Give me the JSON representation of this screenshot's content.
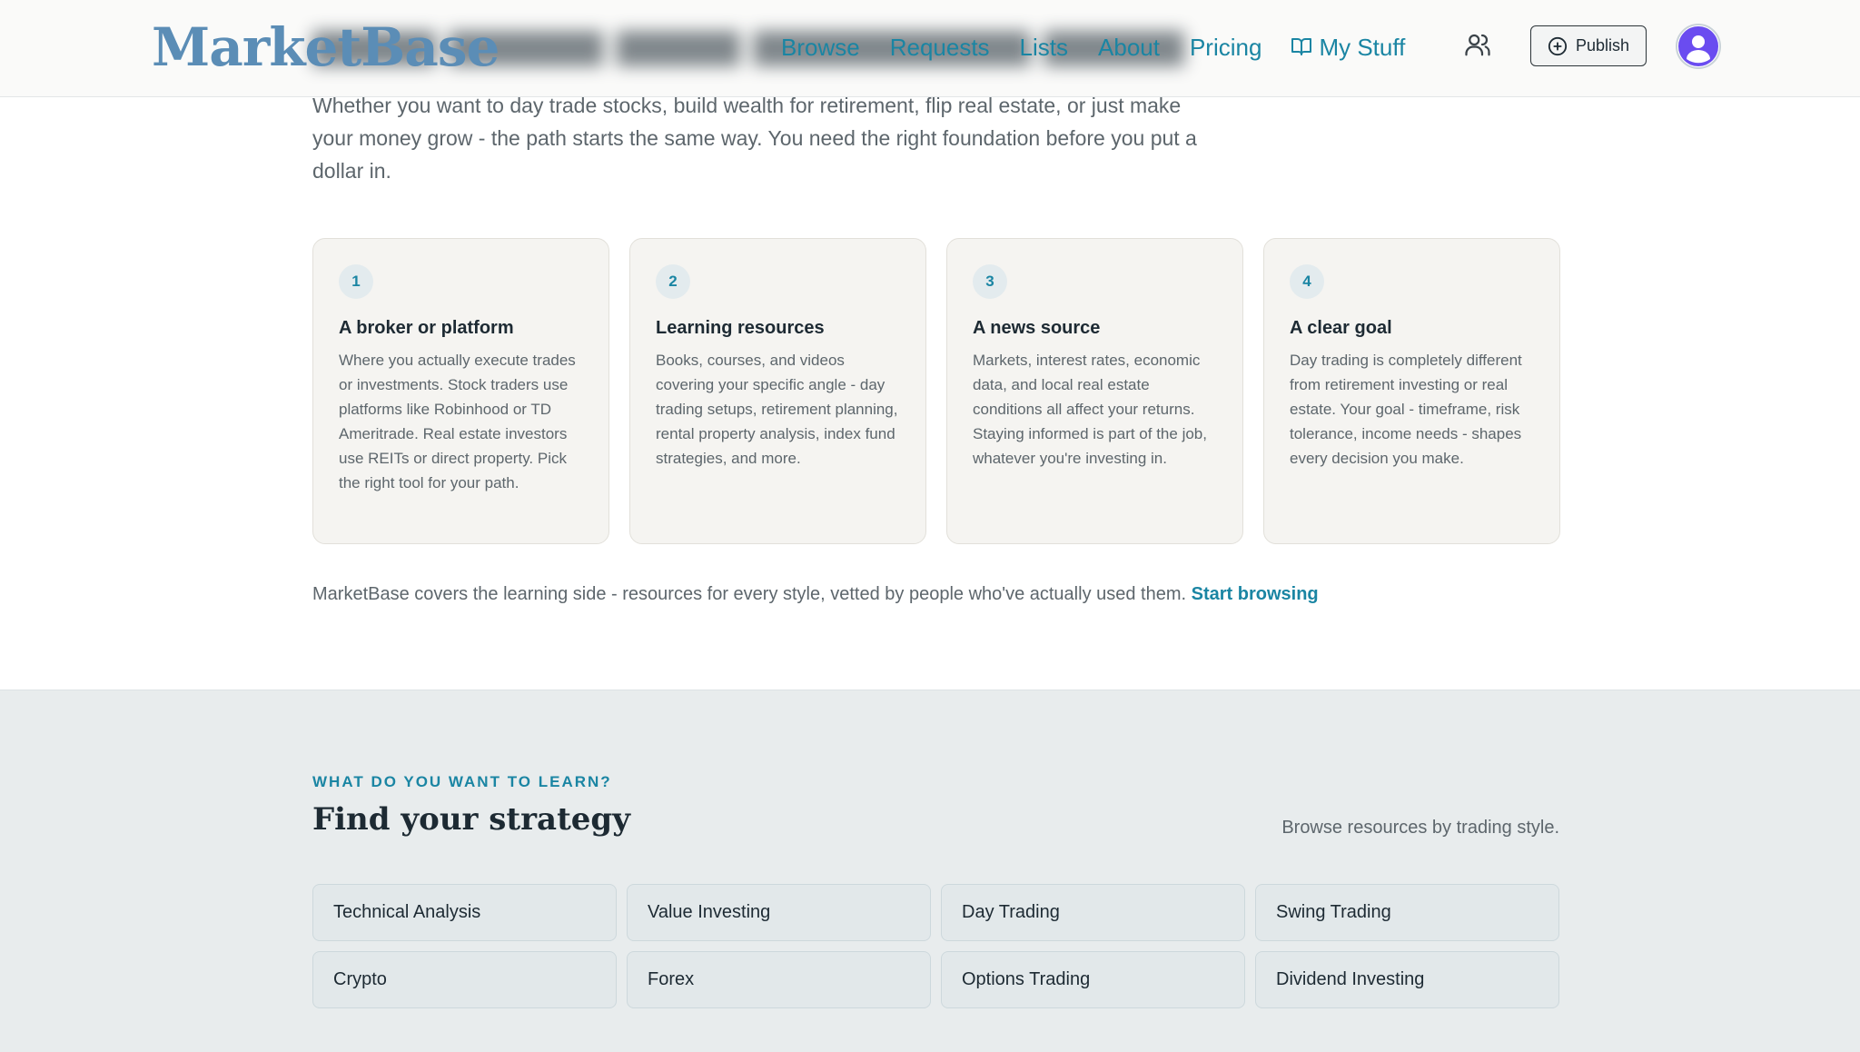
{
  "header": {
    "logo": "MarketBase",
    "nav": [
      {
        "label": "Browse"
      },
      {
        "label": "Requests"
      },
      {
        "label": "Lists"
      },
      {
        "label": "About"
      },
      {
        "label": "Pricing"
      },
      {
        "label": "My Stuff"
      }
    ],
    "publish_label": "Publish"
  },
  "intro": "Whether you want to day trade stocks, build wealth for retirement, flip real estate, or just make your money grow - the path starts the same way. You need the right foundation before you put a dollar in.",
  "cards": [
    {
      "num": "1",
      "title": "A broker or platform",
      "desc": "Where you actually execute trades or investments. Stock traders use platforms like Robinhood or TD Ameritrade. Real estate investors use REITs or direct property. Pick the right tool for your path."
    },
    {
      "num": "2",
      "title": "Learning resources",
      "desc": "Books, courses, and videos covering your specific angle - day trading setups, retirement planning, rental property analysis, index fund strategies, and more."
    },
    {
      "num": "3",
      "title": "A news source",
      "desc": "Markets, interest rates, economic data, and local real estate conditions all affect your returns. Staying informed is part of the job, whatever you're investing in."
    },
    {
      "num": "4",
      "title": "A clear goal",
      "desc": "Day trading is completely different from retirement investing or real estate. Your goal - timeframe, risk tolerance, income needs - shapes every decision you make."
    }
  ],
  "covers": {
    "text": "MarketBase covers the learning side - resources for every style, vetted by people who've actually used them.",
    "link": "Start browsing"
  },
  "strategy": {
    "eyebrow": "WHAT DO YOU WANT TO LEARN?",
    "title": "Find your strategy",
    "subtitle": "Browse resources by trading style.",
    "chips": [
      "Technical Analysis",
      "Value Investing",
      "Day Trading",
      "Swing Trading",
      "Crypto",
      "Forex",
      "Options Trading",
      "Dividend Investing"
    ]
  },
  "colors": {
    "accent": "#1a85a3",
    "logo": "#5b8db6",
    "avatar": "#6a4cf0"
  }
}
